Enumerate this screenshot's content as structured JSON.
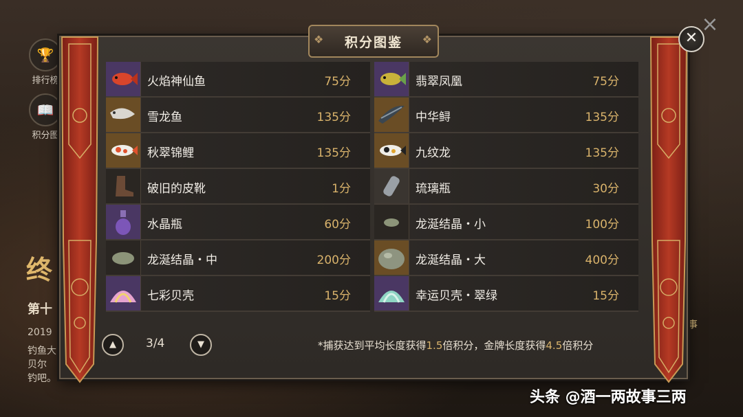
{
  "background": {
    "side_buttons": [
      {
        "label": "排行榜",
        "icon": "trophy-icon"
      },
      {
        "label": "积分图",
        "icon": "book-icon"
      }
    ],
    "title": "终",
    "subtitle": "第十",
    "lines": [
      "2019",
      "钓鱼大",
      "贝尔",
      "钓吧。"
    ],
    "right_label": "事"
  },
  "dialog": {
    "title": "积分图鉴",
    "close_symbol": "✕",
    "items_left": [
      {
        "name": "火焰神仙鱼",
        "points": "75分",
        "icon_color": "#4a3763",
        "glyph": "fish-red"
      },
      {
        "name": "雪龙鱼",
        "points": "135分",
        "icon_color": "#6a4d25",
        "glyph": "fish-silver"
      },
      {
        "name": "秋翠锦鲤",
        "points": "135分",
        "icon_color": "#6a4d25",
        "glyph": "koi"
      },
      {
        "name": "破旧的皮靴",
        "points": "1分",
        "icon_color": "#2a2622",
        "glyph": "boot"
      },
      {
        "name": "水晶瓶",
        "points": "60分",
        "icon_color": "#4a3763",
        "glyph": "bottle-purple"
      },
      {
        "name": "龙涎结晶・中",
        "points": "200分",
        "icon_color": "#2a2622",
        "glyph": "stone-mid"
      },
      {
        "name": "七彩贝壳",
        "points": "15分",
        "icon_color": "#4a3763",
        "glyph": "shell-rainbow"
      }
    ],
    "items_right": [
      {
        "name": "翡翠凤凰",
        "points": "75分",
        "icon_color": "#4a3763",
        "glyph": "fish-green"
      },
      {
        "name": "中华鲟",
        "points": "135分",
        "icon_color": "#6a4d25",
        "glyph": "sturgeon"
      },
      {
        "name": "九纹龙",
        "points": "135分",
        "icon_color": "#6a4d25",
        "glyph": "koi-black"
      },
      {
        "name": "琉璃瓶",
        "points": "30分",
        "icon_color": "#3a3530",
        "glyph": "bottle-glass"
      },
      {
        "name": "龙涎结晶・小",
        "points": "100分",
        "icon_color": "#2a2622",
        "glyph": "stone-small"
      },
      {
        "name": "龙涎结晶・大",
        "points": "400分",
        "icon_color": "#6a4d25",
        "glyph": "stone-big"
      },
      {
        "name": "幸运贝壳・翠绿",
        "points": "15分",
        "icon_color": "#4a3763",
        "glyph": "shell-green"
      }
    ],
    "pager": {
      "prev": "^",
      "next": "v",
      "text": "3/4"
    },
    "note": {
      "p1": "*捕获达到平均长度获得",
      "v1": "1.5",
      "p2": "倍积分，金牌长度获得",
      "v2": "4.5",
      "p3": "倍积分"
    }
  },
  "watermark": "头条 @酒一两故事三两"
}
